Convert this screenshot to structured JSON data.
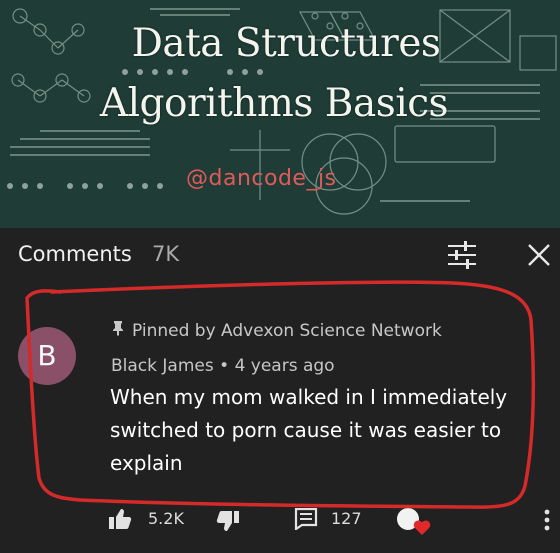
{
  "thumbnail": {
    "title_line1": "Data Structures",
    "title_line2": "Algorithms Basics",
    "handle": "@dancode_js"
  },
  "comments_panel": {
    "label": "Comments",
    "count": "7K",
    "icons": {
      "filter": "filter-sliders-icon",
      "close": "close-icon"
    }
  },
  "comment": {
    "avatar_letter": "B",
    "avatar_color": "#8a5068",
    "pinned_text": "Pinned by Advexon Science Network",
    "author": "Black James",
    "age": "4 years ago",
    "text": "When my mom walked in I immediately switched to porn cause it was easier to explain",
    "likes": "5.2K",
    "replies": "127",
    "icons": {
      "pin": "pin-icon",
      "like": "thumbs-up-icon",
      "dislike": "thumbs-down-icon",
      "reply": "reply-icon",
      "heart": "creator-heart-icon",
      "more": "more-vertical-icon"
    }
  },
  "annotation": {
    "stroke_color": "#d42a2a"
  }
}
